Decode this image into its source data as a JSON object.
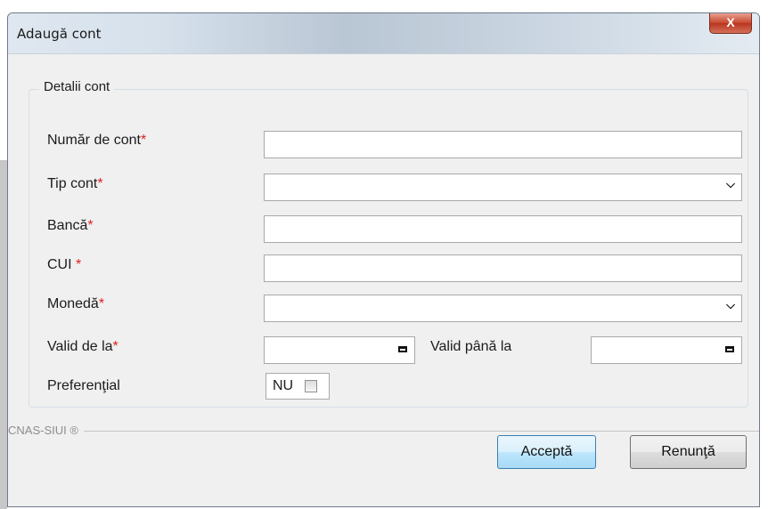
{
  "window": {
    "title": "Adaugă cont",
    "close_label": "X"
  },
  "group": {
    "title": "Detalii cont"
  },
  "fields": {
    "numar_cont": {
      "label": "Număr de cont",
      "required": "*",
      "value": ""
    },
    "tip_cont": {
      "label": "Tip cont",
      "required": "*",
      "value": ""
    },
    "banca": {
      "label": "Bancă",
      "required": "*",
      "value": ""
    },
    "cui": {
      "label": "CUI ",
      "required": "*",
      "value": ""
    },
    "moneda": {
      "label": "Monedă",
      "required": "*",
      "value": ""
    },
    "valid_de_la": {
      "label": "Valid de la",
      "required": "*",
      "value": ""
    },
    "valid_pana_la": {
      "label": "Valid până la",
      "value": ""
    },
    "preferential": {
      "label": "Preferenţial",
      "value": "NU",
      "checked": false
    }
  },
  "footer": {
    "brand": "CNAS-SIUI ®"
  },
  "buttons": {
    "accept": "Acceptă",
    "cancel": "Renunţă"
  },
  "icons": {
    "close": "close-icon",
    "dropdown": "chevron-down-icon",
    "calendar": "calendar-icon"
  }
}
